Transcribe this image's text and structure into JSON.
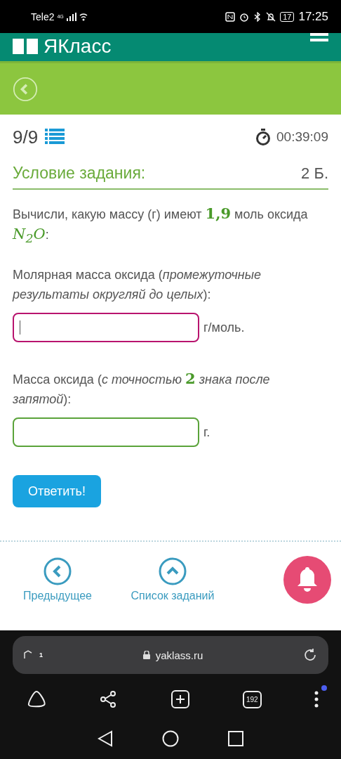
{
  "status_bar": {
    "carrier": "Tele2",
    "network": "4G",
    "battery": "17",
    "time": "17:25"
  },
  "header": {
    "logo": "ЯКласс"
  },
  "task": {
    "counter": "9/9",
    "timer": "00:39:09",
    "section_title": "Условие задания:",
    "points": "2 Б.",
    "question": [
      {
        "kind": "text",
        "text": "Вычисли, какую массу (г) имеют "
      },
      {
        "kind": "math",
        "text": "1,9"
      },
      {
        "kind": "text",
        "text": " моль оксида "
      },
      {
        "kind": "math",
        "text": "N$_{2}$O"
      },
      {
        "kind": "text",
        "text": ":"
      }
    ],
    "fields": [
      {
        "label": [
          {
            "kind": "text",
            "text": "Молярная масса оксида ("
          },
          {
            "kind": "italic",
            "text": "промежуточные результаты округляй до целых"
          },
          {
            "kind": "text",
            "text": "):"
          }
        ],
        "unit": "г/моль.",
        "focused": true
      },
      {
        "label": [
          {
            "kind": "text",
            "text": "Масса оксида ("
          },
          {
            "kind": "italic",
            "text": "с точностью "
          },
          {
            "kind": "math",
            "text": "2"
          },
          {
            "kind": "italic",
            "text": " знака после запятой"
          },
          {
            "kind": "text",
            "text": "):"
          }
        ],
        "unit": "г.",
        "focused": false
      }
    ],
    "submit": "Ответить!"
  },
  "bottom_nav": {
    "previous": "Предыдущее",
    "list": "Список заданий"
  },
  "browser": {
    "tabs_badge": "1",
    "url": "yaklass.ru",
    "tab_count": "192",
    "has_notification": true
  }
}
